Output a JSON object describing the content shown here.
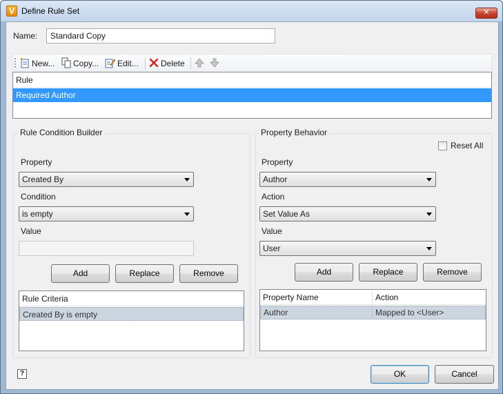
{
  "window": {
    "title": "Define Rule Set",
    "icon_letter": "V",
    "close_glyph": "✕"
  },
  "name_field": {
    "label": "Name:",
    "value": "Standard Copy"
  },
  "toolbar": {
    "new_label": "New...",
    "copy_label": "Copy...",
    "edit_label": "Edit...",
    "delete_label": "Delete"
  },
  "rules": {
    "column_header": "Rule",
    "rows": [
      "Required Author"
    ]
  },
  "condition_builder": {
    "title": "Rule Condition Builder",
    "property_label": "Property",
    "property_value": "Created By",
    "condition_label": "Condition",
    "condition_value": "is empty",
    "value_label": "Value",
    "value_text": "",
    "add_label": "Add",
    "replace_label": "Replace",
    "remove_label": "Remove",
    "criteria_header": "Rule Criteria",
    "criteria_rows": [
      "Created By is empty"
    ]
  },
  "property_behavior": {
    "title": "Property Behavior",
    "reset_all_label": "Reset All",
    "property_label": "Property",
    "property_value": "Author",
    "action_label": "Action",
    "action_value": "Set Value As",
    "value_label": "Value",
    "value_value": "User",
    "add_label": "Add",
    "replace_label": "Replace",
    "remove_label": "Remove",
    "columns": [
      "Property Name",
      "Action"
    ],
    "rows": [
      {
        "name": "Author",
        "action": "Mapped to <User>"
      }
    ]
  },
  "footer": {
    "help_glyph": "?",
    "ok_label": "OK",
    "cancel_label": "Cancel"
  },
  "colors": {
    "selection_blue": "#3399ff",
    "selection_gray": "#ccd6e0"
  }
}
